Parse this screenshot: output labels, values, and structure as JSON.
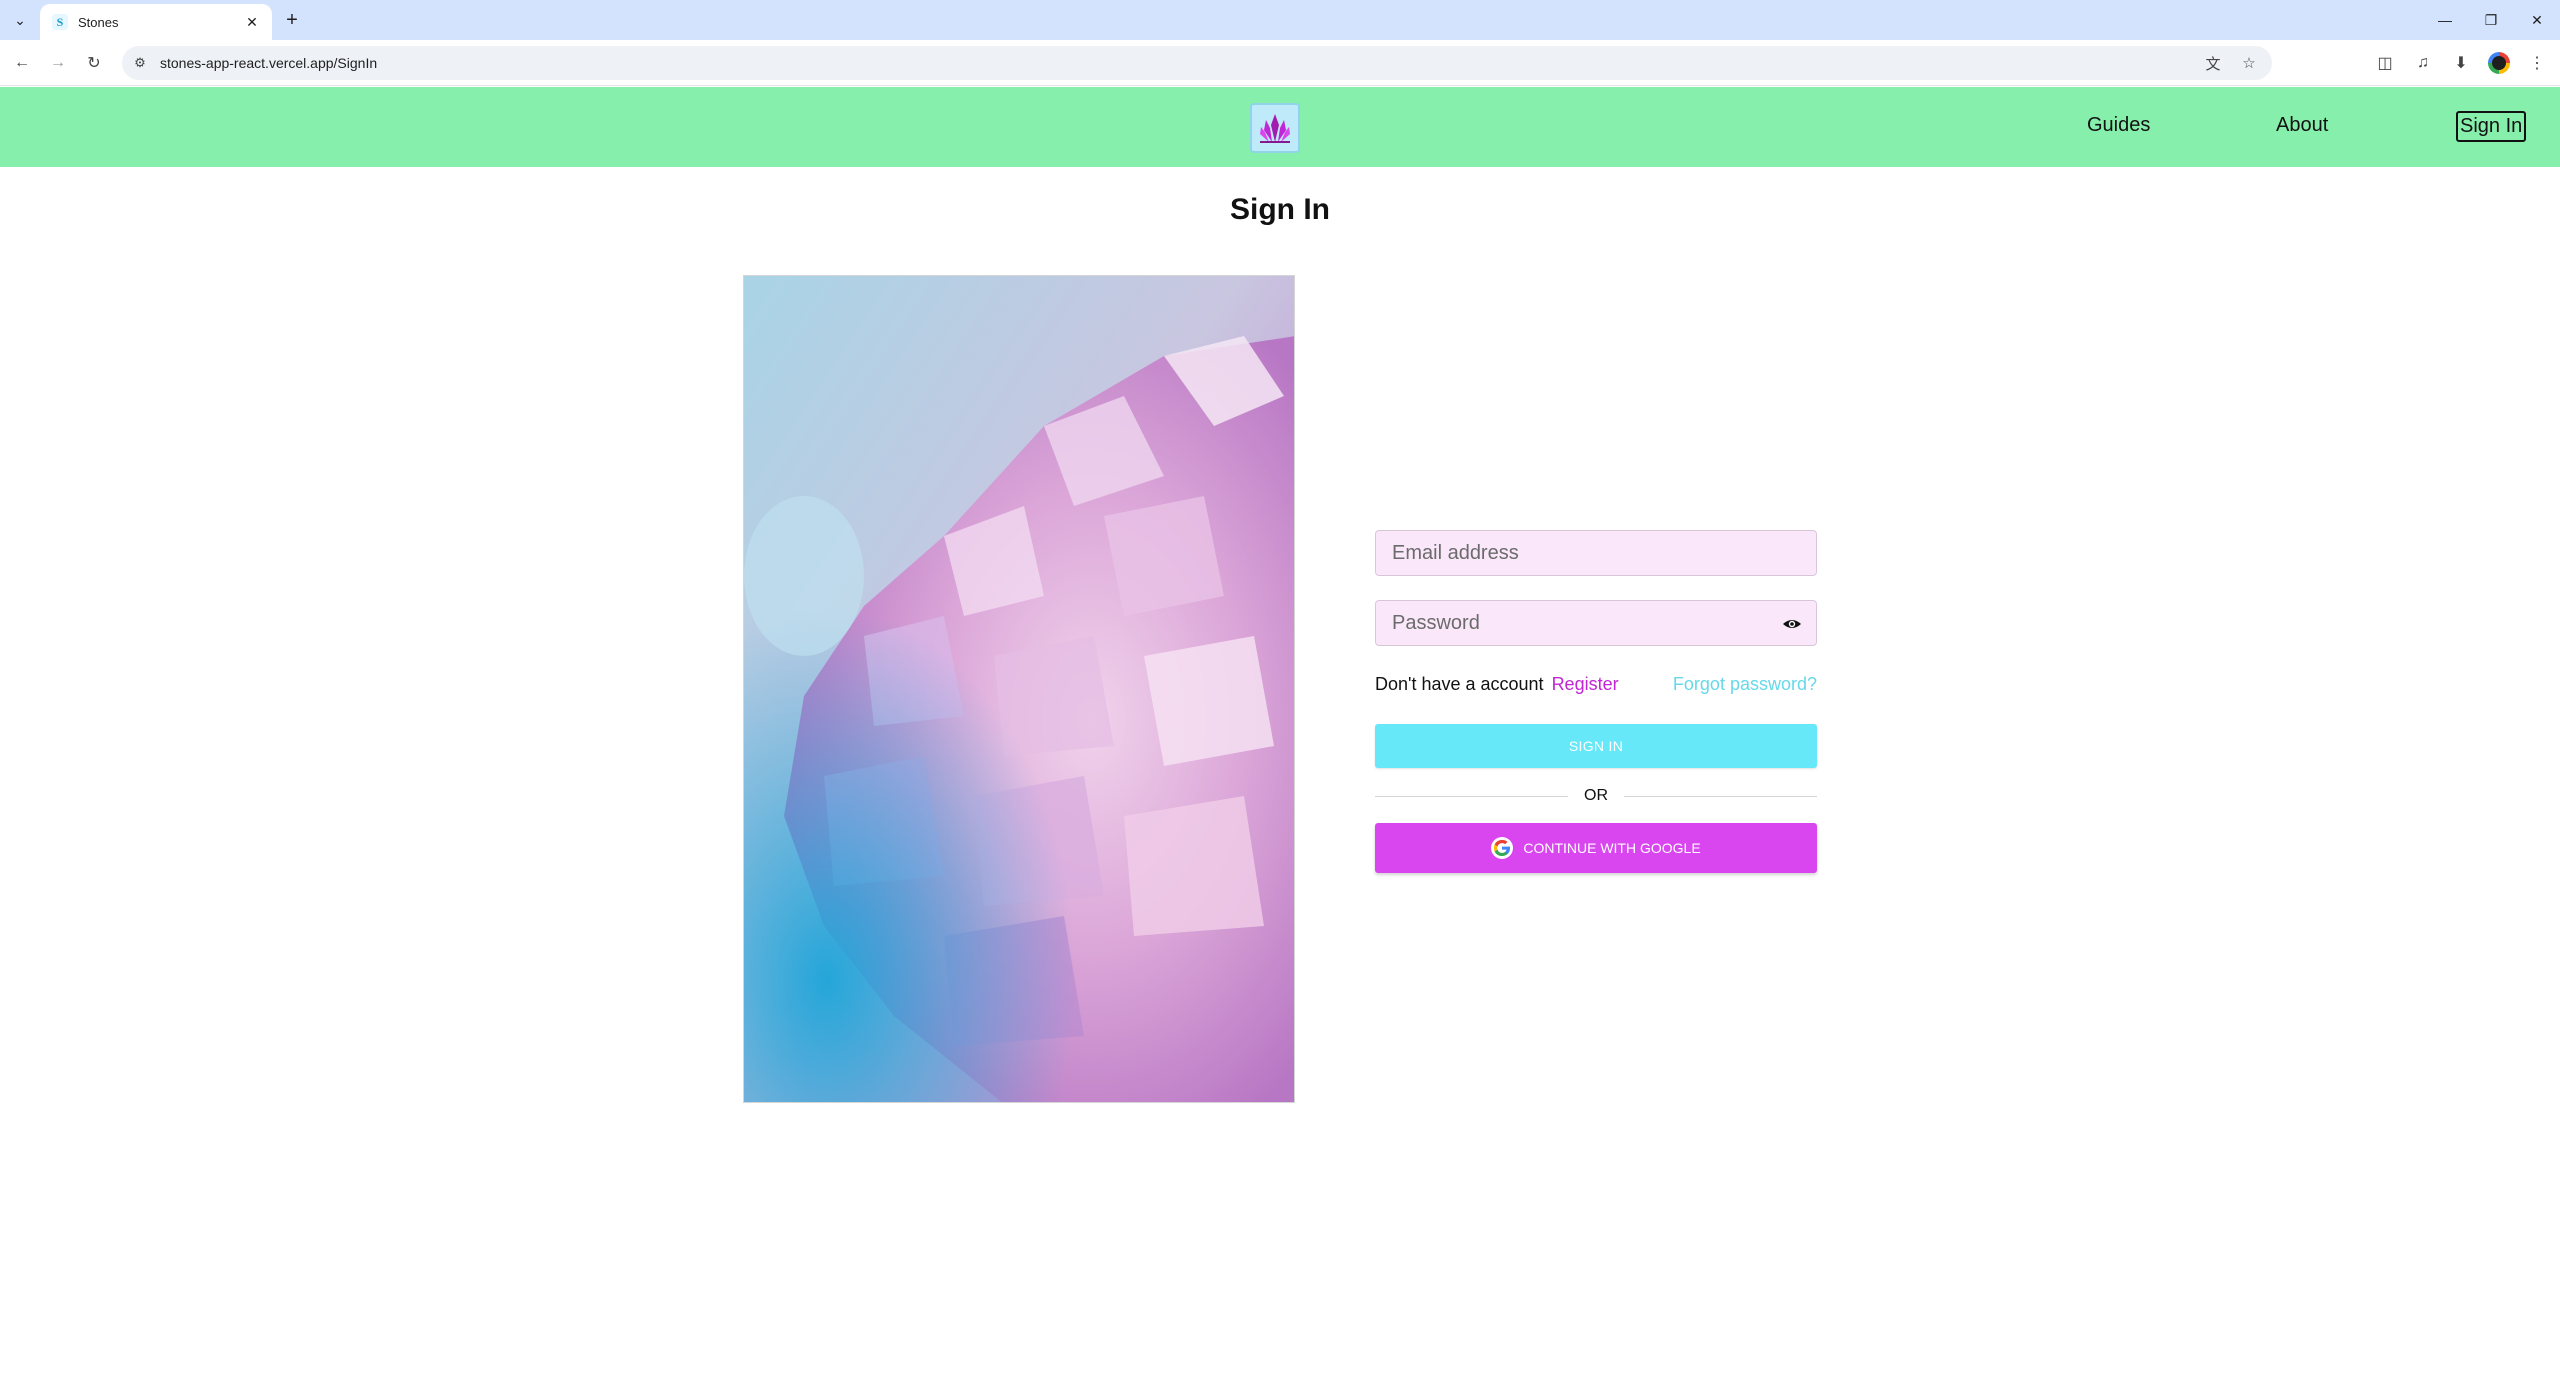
{
  "browser": {
    "tab_title": "Stones",
    "tab_favicon_letter": "S",
    "url": "stones-app-react.vercel.app/SignIn"
  },
  "header": {
    "logo_icon": "crystal-logo-icon",
    "nav": {
      "guides": "Guides",
      "about": "About",
      "sign_in": "Sign In"
    },
    "background_color": "#86efac"
  },
  "page": {
    "title": "Sign In",
    "image_icon": "crystal-photo"
  },
  "form": {
    "email_placeholder": "Email address",
    "password_placeholder": "Password",
    "no_account_text": "Don't have a account",
    "register_link": "Register",
    "forgot_link": "Forgot password?",
    "signin_button": "SIGN IN",
    "or_divider": "OR",
    "google_button": "CONTINUE WITH GOOGLE"
  },
  "colors": {
    "signin_button": "#67e8f9",
    "google_button": "#d946ef",
    "input_bg": "#fae8fa",
    "register_link": "#c026d3",
    "forgot_link": "#67d8ea"
  }
}
